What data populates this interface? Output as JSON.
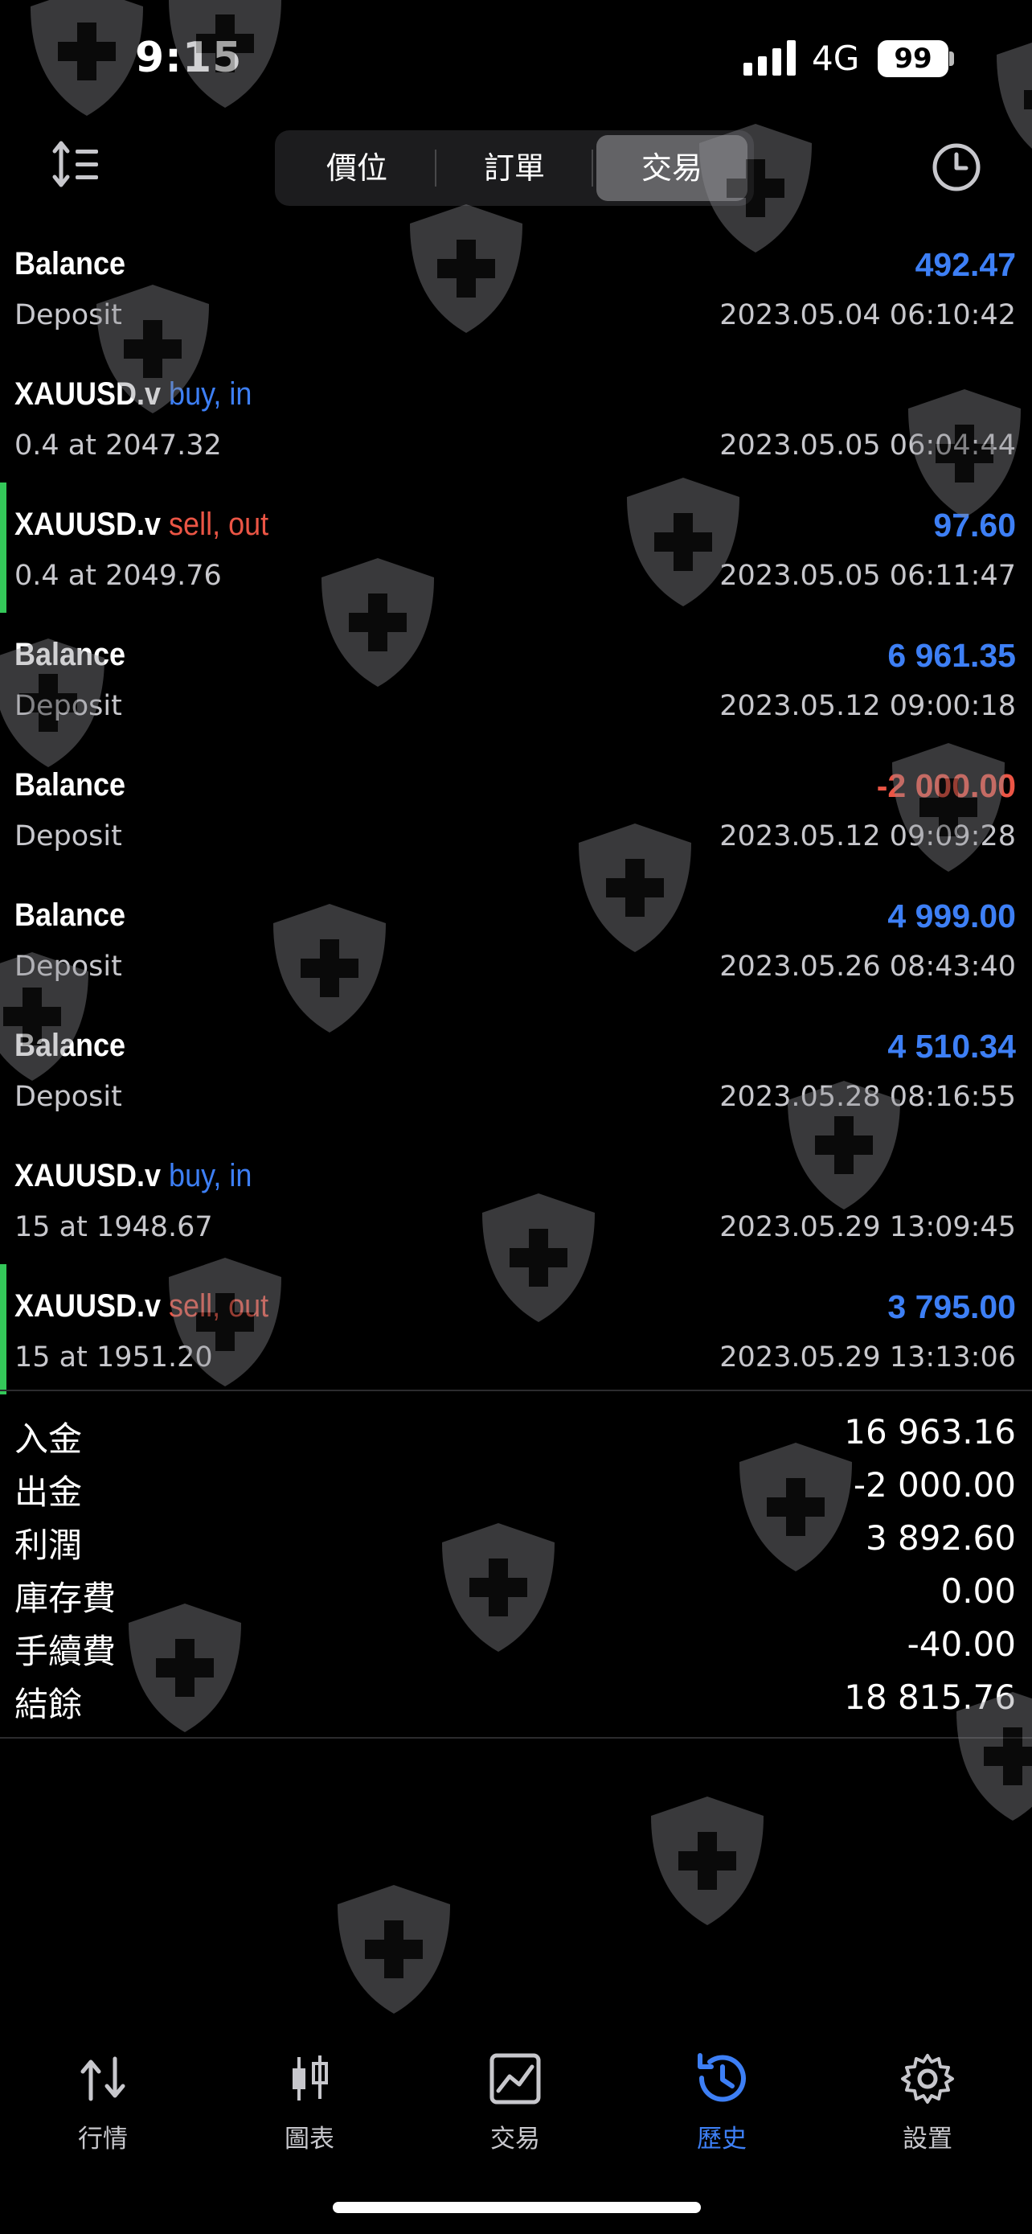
{
  "status": {
    "time": "9:15",
    "network": "4G",
    "battery": "99"
  },
  "header": {
    "segments": [
      {
        "label": "價位",
        "active": false
      },
      {
        "label": "訂單",
        "active": false
      },
      {
        "label": "交易",
        "active": true
      }
    ]
  },
  "deals": [
    {
      "symbol": "Balance",
      "action": "",
      "subtitle": "Deposit",
      "amount": "492.47",
      "amount_color": "blue",
      "time": "2023.05.04 06:10:42",
      "bar": false
    },
    {
      "symbol": "XAUUSD.v",
      "action": "buy, in",
      "action_color": "blue",
      "subtitle": "0.4 at 2047.32",
      "amount": "",
      "time": "2023.05.05 06:04:44",
      "bar": false
    },
    {
      "symbol": "XAUUSD.v",
      "action": "sell, out",
      "action_color": "red",
      "subtitle": "0.4 at 2049.76",
      "amount": "97.60",
      "amount_color": "blue",
      "time": "2023.05.05 06:11:47",
      "bar": true
    },
    {
      "symbol": "Balance",
      "action": "",
      "subtitle": "Deposit",
      "amount": "6 961.35",
      "amount_color": "blue",
      "time": "2023.05.12 09:00:18",
      "bar": false
    },
    {
      "symbol": "Balance",
      "action": "",
      "subtitle": "Deposit",
      "amount": "-2 000.00",
      "amount_color": "red",
      "time": "2023.05.12 09:09:28",
      "bar": false
    },
    {
      "symbol": "Balance",
      "action": "",
      "subtitle": "Deposit",
      "amount": "4 999.00",
      "amount_color": "blue",
      "time": "2023.05.26 08:43:40",
      "bar": false
    },
    {
      "symbol": "Balance",
      "action": "",
      "subtitle": "Deposit",
      "amount": "4 510.34",
      "amount_color": "blue",
      "time": "2023.05.28 08:16:55",
      "bar": false
    },
    {
      "symbol": "XAUUSD.v",
      "action": "buy, in",
      "action_color": "blue",
      "subtitle": "15 at 1948.67",
      "amount": "",
      "time": "2023.05.29 13:09:45",
      "bar": false
    },
    {
      "symbol": "XAUUSD.v",
      "action": "sell, out",
      "action_color": "red",
      "subtitle": "15 at 1951.20",
      "amount": "3 795.00",
      "amount_color": "blue",
      "time": "2023.05.29 13:13:06",
      "bar": true
    }
  ],
  "summary": [
    {
      "label": "入金",
      "value": "16 963.16"
    },
    {
      "label": "出金",
      "value": "-2 000.00"
    },
    {
      "label": "利潤",
      "value": "3 892.60"
    },
    {
      "label": "庫存費",
      "value": "0.00"
    },
    {
      "label": "手續費",
      "value": "-40.00"
    },
    {
      "label": "結餘",
      "value": "18 815.76"
    }
  ],
  "tabbar": {
    "tabs": [
      {
        "label": "行情",
        "icon": "quotes-arrows-icon",
        "active": false
      },
      {
        "label": "圖表",
        "icon": "chart-candles-icon",
        "active": false
      },
      {
        "label": "交易",
        "icon": "trade-chart-icon",
        "active": false
      },
      {
        "label": "歷史",
        "icon": "history-clock-icon",
        "active": true
      },
      {
        "label": "設置",
        "icon": "settings-gear-icon",
        "active": false
      }
    ]
  },
  "colors": {
    "blue": "#3d7ff5",
    "red": "#eb5545",
    "green_bar": "#34c759",
    "background": "#000000"
  },
  "watermark_icon": "shield-cross-icon"
}
